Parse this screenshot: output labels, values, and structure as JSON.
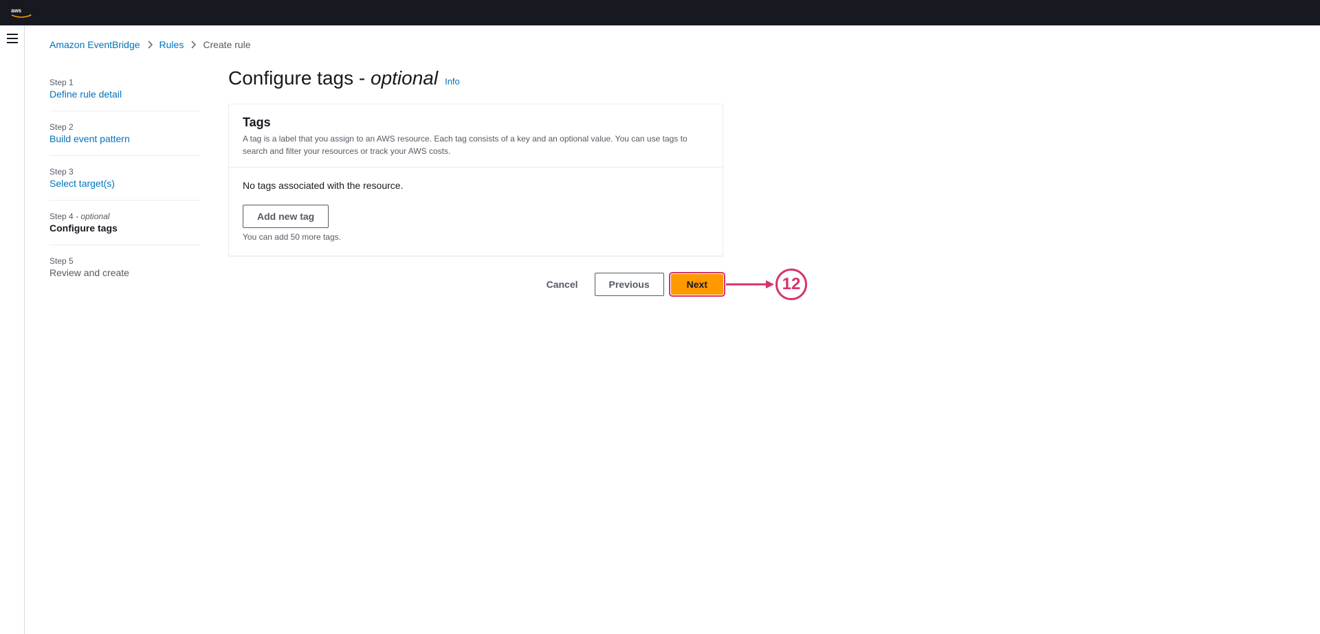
{
  "breadcrumb": {
    "items": [
      {
        "label": "Amazon EventBridge",
        "link": true
      },
      {
        "label": "Rules",
        "link": true
      },
      {
        "label": "Create rule",
        "link": false
      }
    ]
  },
  "steps": [
    {
      "num": "Step 1",
      "title": "Define rule detail",
      "state": "link"
    },
    {
      "num": "Step 2",
      "title": "Build event pattern",
      "state": "link"
    },
    {
      "num": "Step 3",
      "title": "Select target(s)",
      "state": "link"
    },
    {
      "num": "Step 4",
      "optional": " - optional",
      "title": "Configure tags",
      "state": "active"
    },
    {
      "num": "Step 5",
      "title": "Review and create",
      "state": "future"
    }
  ],
  "page": {
    "title_main": "Configure tags - ",
    "title_optional": "optional",
    "info": "Info"
  },
  "panel": {
    "heading": "Tags",
    "description": "A tag is a label that you assign to an AWS resource. Each tag consists of a key and an optional value. You can use tags to search and filter your resources or track your AWS costs.",
    "empty": "No tags associated with the resource.",
    "add_button": "Add new tag",
    "helper": "You can add 50 more tags."
  },
  "footer": {
    "cancel": "Cancel",
    "previous": "Previous",
    "next": "Next"
  },
  "annotation": {
    "number": "12"
  }
}
